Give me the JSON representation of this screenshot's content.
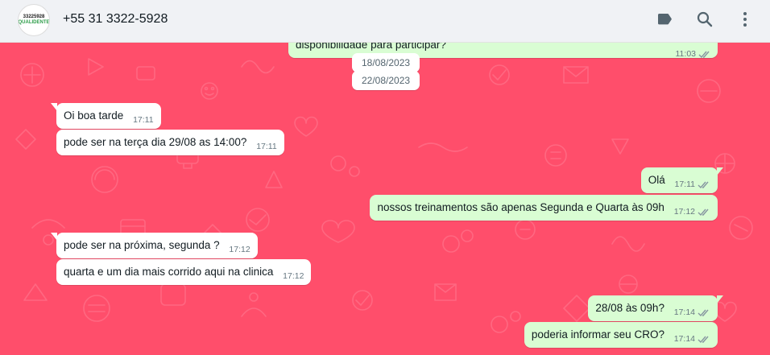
{
  "header": {
    "avatar": {
      "line1": "33225928",
      "line2": "QUALIDENTE"
    },
    "contact_name": "+55 31 3322-5928",
    "icons": [
      "label-icon",
      "search-icon",
      "menu-icon"
    ]
  },
  "chat": {
    "background_color": "#ff4e6b",
    "top_partial_message": {
      "text": "disponibilidade para participar?",
      "time": "11:03"
    },
    "date_pills": [
      "18/08/2023",
      "22/08/2023"
    ],
    "messages": [
      {
        "direction": "in",
        "text": "Oi boa tarde",
        "time": "17:11"
      },
      {
        "direction": "in",
        "text": "pode ser na terça dia 29/08 as 14:00?",
        "time": "17:11"
      },
      {
        "direction": "out",
        "text": "Olá",
        "time": "17:11"
      },
      {
        "direction": "out",
        "text": "nossos treinamentos são apenas Segunda e Quarta às 09h",
        "time": "17:12"
      },
      {
        "direction": "in",
        "text": "pode ser na próxima, segunda ?",
        "time": "17:12"
      },
      {
        "direction": "in",
        "text": "quarta e um dia mais corrido aqui na clinica",
        "time": "17:12"
      },
      {
        "direction": "out",
        "text": "28/08 às 09h?",
        "time": "17:14"
      },
      {
        "direction": "out",
        "text": "poderia informar seu CRO?",
        "time": "17:14"
      }
    ]
  }
}
